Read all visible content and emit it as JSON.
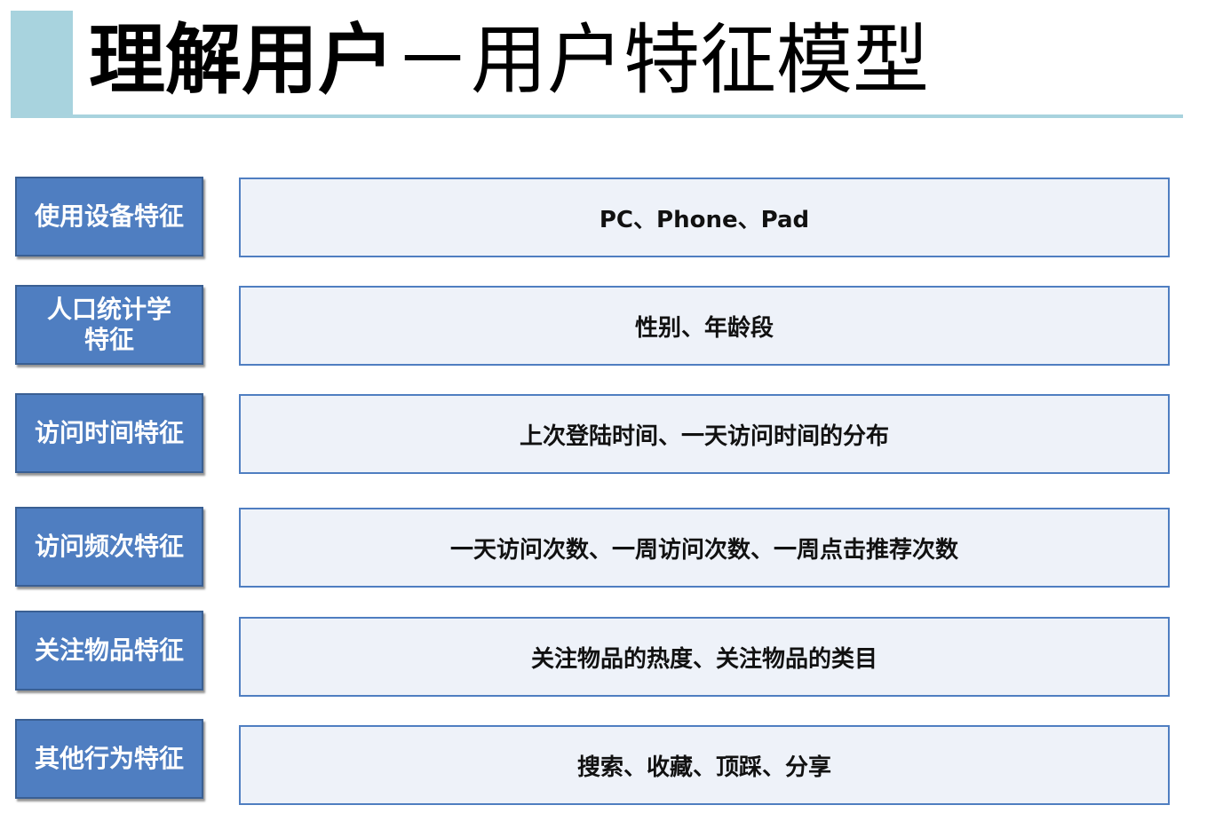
{
  "slide": {
    "title_bold": "理解用户",
    "title_rest": "－用户特征模型",
    "accent_color": "#a8d3de",
    "label_color": "#4f7ec1",
    "value_bg_color": "#eef2f9"
  },
  "rows": [
    {
      "label": "使用设备特征",
      "value": "PC、Phone、Pad"
    },
    {
      "label": "人口统计学特征",
      "value": "性别、年龄段"
    },
    {
      "label": "访问时间特征",
      "value": "上次登陆时间、一天访问时间的分布"
    },
    {
      "label": "访问频次特征",
      "value": "一天访问次数、一周访问次数、一周点击推荐次数"
    },
    {
      "label": "关注物品特征",
      "value": "关注物品的热度、关注物品的类目"
    },
    {
      "label": "其他行为特征",
      "value": "搜索、收藏、顶踩、分享"
    }
  ]
}
